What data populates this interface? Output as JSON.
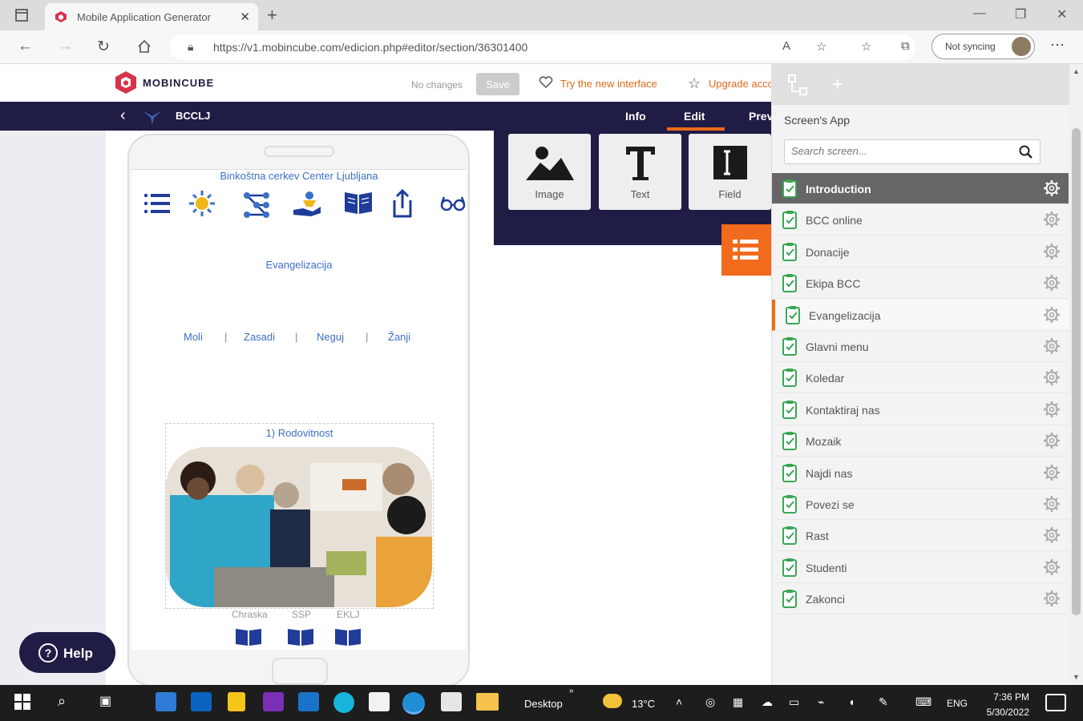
{
  "browser": {
    "tab_title": "Mobile Application Generator",
    "url": "https://v1.mobincube.com/edicion.php#editor/section/36301400",
    "sync_label": "Not syncing"
  },
  "app_header": {
    "logo_text": "MOBINCUBE",
    "status": "No changes",
    "save_label": "Save",
    "try_new": "Try the new interface",
    "upgrade": "Upgrade account"
  },
  "app_nav": {
    "app_name": "BCCLJ",
    "tabs": [
      "Info",
      "Edit",
      "Preview"
    ]
  },
  "components": [
    "Image",
    "Text",
    "Field"
  ],
  "phone": {
    "church_title": "Binkoštna cerkev Center Ljubljana",
    "section_title": "Evangelizacija",
    "menu": [
      "Moli",
      "Zasadi",
      "Neguj",
      "Žanji"
    ],
    "image_title": "1) Rodovitnost",
    "bottom_labels": [
      "Chraska",
      "SSP",
      "EKLJ"
    ]
  },
  "help_label": "Help",
  "side_panel": {
    "title": "Screen's App",
    "search_placeholder": "Search screen...",
    "screens": [
      "Introduction",
      "BCC online",
      "Donacije",
      "Ekipa BCC",
      "Evangelizacija",
      "Glavni menu",
      "Koledar",
      "Kontaktiraj nas",
      "Mozaik",
      "Najdi nas",
      "Povezi se",
      "Rast",
      "Studenti",
      "Zakonci"
    ],
    "selected": "Introduction",
    "current": "Evangelizacija"
  },
  "taskbar": {
    "desktop": "Desktop",
    "temperature": "13°C",
    "language": "ENG",
    "time": "7:36 PM",
    "date": "5/30/2022"
  },
  "colors": {
    "accent": "#f26a1b",
    "navy": "#1f1c45",
    "link_blue": "#3c6fc9"
  }
}
